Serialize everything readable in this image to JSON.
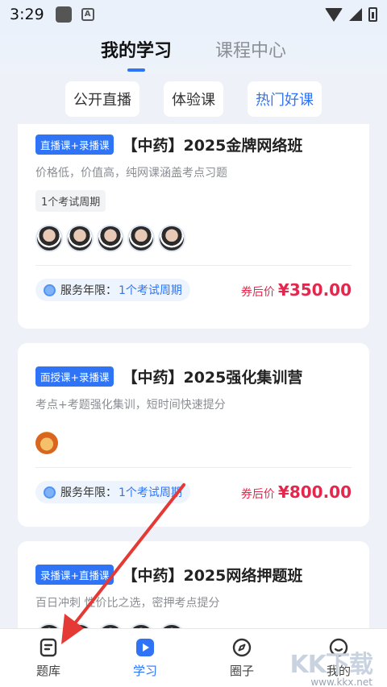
{
  "status_bar": {
    "time": "3:29"
  },
  "top_tabs": [
    {
      "label": "我的学习",
      "active": true
    },
    {
      "label": "课程中心",
      "active": false
    }
  ],
  "filters": [
    {
      "label": "公开直播",
      "active": false
    },
    {
      "label": "体验课",
      "active": false
    },
    {
      "label": "热门好课",
      "active": true
    }
  ],
  "courses": [
    {
      "tag": "直播课+录播课",
      "title": "【中药】2025金牌网络班",
      "subtitle": "价格低，价值高，纯网课涵盖考点习题",
      "badge": "1个考试周期",
      "service_label": "服务年限：",
      "service_value": "1个考试周期",
      "price_label": "券后价",
      "price": "¥350.00"
    },
    {
      "tag": "面授课+录播课",
      "title": "【中药】2025强化集训营",
      "subtitle": "考点+考题强化集训，短时间快速提分",
      "service_label": "服务年限：",
      "service_value": "1个考试周期",
      "price_label": "券后价",
      "price": "¥800.00"
    },
    {
      "tag": "录播课+直播课",
      "title": "【中药】2025网络押题班",
      "subtitle": "百日冲刺 性价比之选，密押考点提分"
    }
  ],
  "bottom_nav": [
    {
      "label": "题库",
      "icon": "question-bank-icon",
      "active": false
    },
    {
      "label": "学习",
      "icon": "play-icon",
      "active": true
    },
    {
      "label": "圈子",
      "icon": "compass-icon",
      "active": false
    },
    {
      "label": "我的",
      "icon": "user-icon",
      "active": false
    }
  ],
  "watermark": {
    "logo": "KK下载",
    "url": "www.kkx.net"
  },
  "colors": {
    "accent": "#2f74f6",
    "price": "#e5274d",
    "annotation": "#e53935"
  }
}
